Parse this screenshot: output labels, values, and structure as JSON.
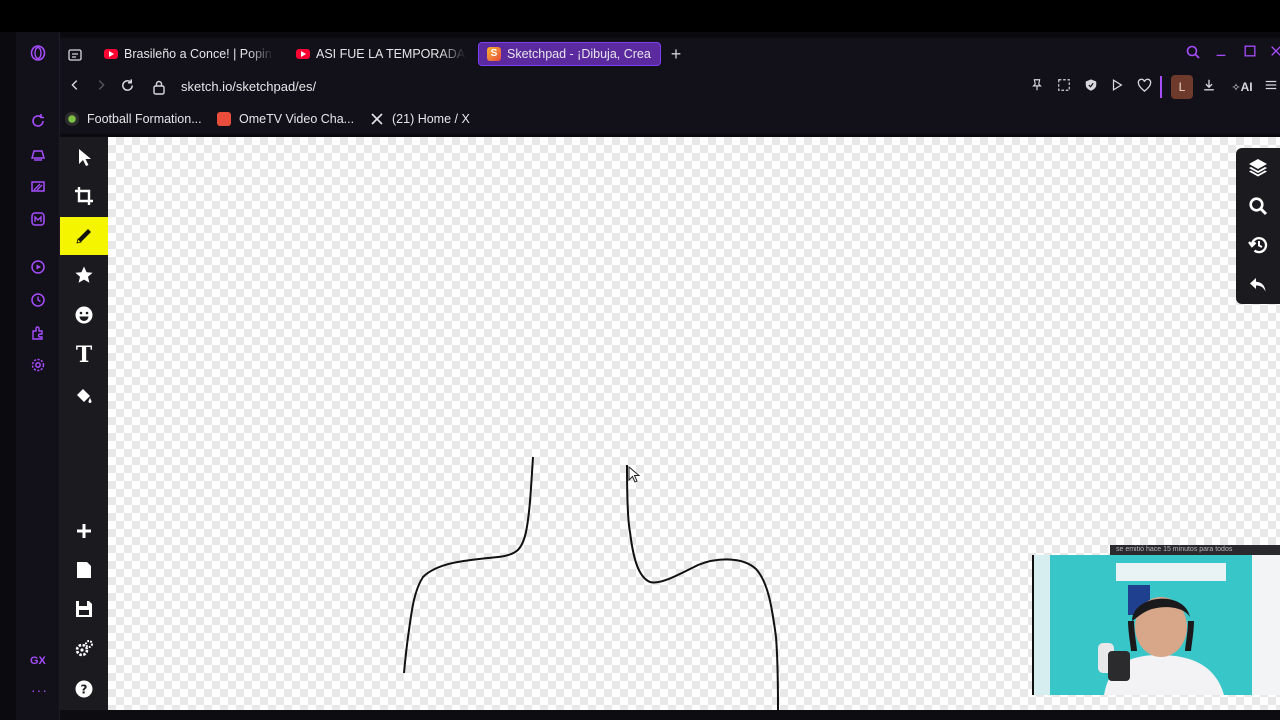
{
  "browser": {
    "name": "Opera GX",
    "accent_color": "#a64dff",
    "tabs": [
      {
        "title": "Brasileño a Conce! | Popin",
        "icon": "youtube-icon"
      },
      {
        "title": "ASI FUE LA TEMPORADA",
        "icon": "youtube-icon"
      },
      {
        "title": "Sketchpad - ¡Dibuja, Crea",
        "icon": "sketchpad-icon",
        "active": true
      }
    ],
    "new_tab_label": "+",
    "address": "sketch.io/sketchpad/es/",
    "profile_initial": "L",
    "ai_label": "AI",
    "gx_label": "GX",
    "more_label": "···",
    "bookmarks": [
      {
        "label": "Football Formation...",
        "icon": "football-icon"
      },
      {
        "label": "OmeTV Video Cha...",
        "icon": "ometv-icon"
      },
      {
        "label": "(21) Home / X",
        "icon": "x-icon"
      }
    ]
  },
  "sketchpad": {
    "active_tool": "pencil",
    "left_tools": [
      "select",
      "crop",
      "pencil",
      "stamp",
      "emoji",
      "text",
      "fill"
    ],
    "left_bottom_tools": [
      "add",
      "open",
      "save",
      "settings",
      "help"
    ],
    "text_tool_label": "T",
    "right_tools": [
      "layers",
      "zoom",
      "history",
      "undo"
    ]
  },
  "webcam": {
    "overlay_text": "se emitió hace 15 minutos para todos"
  }
}
